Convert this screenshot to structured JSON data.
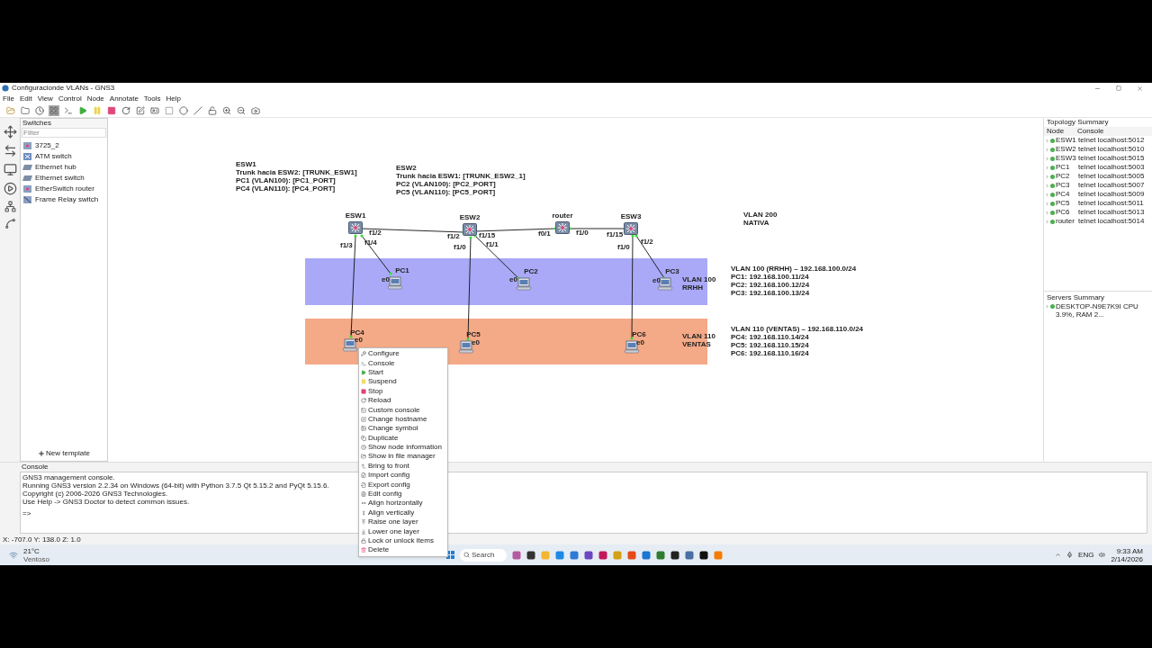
{
  "window": {
    "title": "Configuracionde VLANs - GNS3"
  },
  "menu": [
    "File",
    "Edit",
    "View",
    "Control",
    "Node",
    "Annotate",
    "Tools",
    "Help"
  ],
  "toolbar": {
    "toggle_pressed": true
  },
  "switches_panel": {
    "title": "Switches",
    "filter_placeholder": "Filter",
    "items": [
      {
        "label": "3725_2",
        "kind": "router"
      },
      {
        "label": "ATM switch",
        "kind": "atm"
      },
      {
        "label": "Ethernet hub",
        "kind": "hub"
      },
      {
        "label": "Ethernet switch",
        "kind": "hub"
      },
      {
        "label": "EtherSwitch router",
        "kind": "router"
      },
      {
        "label": "Frame Relay switch",
        "kind": "frame"
      }
    ],
    "new_template": "New template"
  },
  "canvas": {
    "zones": [
      {
        "color": "#a9a9f7"
      },
      {
        "color": "#f4a987"
      }
    ],
    "notes": [
      {
        "lines": [
          "ESW1",
          "Trunk hacia ESW2: [TRUNK_ESW1]",
          "PC1 (VLAN100): [PC1_PORT]",
          "PC4 (VLAN110): [PC4_PORT]"
        ]
      },
      {
        "lines": [
          "ESW2",
          "Trunk hacia ESW1: [TRUNK_ESW2_1]",
          "PC2 (VLAN100): [PC2_PORT]",
          "PC5 (VLAN110): [PC5_PORT]"
        ]
      },
      {
        "lines": [
          "VLAN 200",
          "NATIVA"
        ]
      },
      {
        "lines": [
          "VLAN 100",
          "RRHH"
        ]
      },
      {
        "lines": [
          "VLAN 100 (RRHH) – 192.168.100.0/24",
          "PC1: 192.168.100.11/24",
          "PC2: 192.168.100.12/24",
          "PC3: 192.168.100.13/24"
        ]
      },
      {
        "lines": [
          "VLAN 110",
          "VENTAS"
        ]
      },
      {
        "lines": [
          "VLAN 110 (VENTAS) – 192.168.110.0/24",
          "PC4: 192.168.110.14/24",
          "PC5: 192.168.110.15/24",
          "PC6: 192.168.110.16/24"
        ]
      }
    ],
    "nodes": [
      {
        "label": "ESW1",
        "kind": "switch"
      },
      {
        "label": "ESW2",
        "kind": "switch"
      },
      {
        "label": "router",
        "kind": "switch"
      },
      {
        "label": "ESW3",
        "kind": "switch"
      },
      {
        "label": "PC1",
        "kind": "pc"
      },
      {
        "label": "PC2",
        "kind": "pc"
      },
      {
        "label": "PC3",
        "kind": "pc"
      },
      {
        "label": "PC4",
        "kind": "pc"
      },
      {
        "label": "PC5",
        "kind": "pc"
      },
      {
        "label": "PC6",
        "kind": "pc"
      }
    ],
    "port_labels": [
      "f1/2",
      "f1/3",
      "f1/4",
      "f1/2",
      "f1/15",
      "f1/1",
      "f1/0",
      "f0/1",
      "f1/0",
      "f1/15",
      "f1/0",
      "f1/2",
      "e0",
      "e0",
      "e0",
      "e0",
      "e0",
      "e0"
    ]
  },
  "topology_summary": {
    "title": "Topology Summary",
    "columns": [
      "Node",
      "Console"
    ],
    "rows": [
      {
        "node": "ESW1",
        "console": "telnet localhost:5012",
        "started": true
      },
      {
        "node": "ESW2",
        "console": "telnet localhost:5010",
        "started": true
      },
      {
        "node": "ESW3",
        "console": "telnet localhost:5015",
        "started": true
      },
      {
        "node": "PC1",
        "console": "telnet localhost:5003",
        "started": true
      },
      {
        "node": "PC2",
        "console": "telnet localhost:5005",
        "started": true
      },
      {
        "node": "PC3",
        "console": "telnet localhost:5007",
        "started": true
      },
      {
        "node": "PC4",
        "console": "telnet localhost:5009",
        "started": true
      },
      {
        "node": "PC5",
        "console": "telnet localhost:5011",
        "started": true
      },
      {
        "node": "PC6",
        "console": "telnet localhost:5013",
        "started": true
      },
      {
        "node": "router",
        "console": "telnet localhost:5014",
        "started": true
      }
    ]
  },
  "servers_summary": {
    "title": "Servers Summary",
    "rows": [
      {
        "text": "DESKTOP-N9E7K9I CPU 3.9%, RAM 2...",
        "started": true
      }
    ]
  },
  "console": {
    "title": "Console",
    "lines": [
      "GNS3 management console.",
      "Running GNS3 version 2.2.34 on Windows (64-bit) with Python 3.7.5 Qt 5.15.2 and PyQt 5.15.6.",
      "Copyright (c) 2006-2026 GNS3 Technologies.",
      "Use Help -> GNS3 Doctor to detect common issues."
    ],
    "prompt": "=>"
  },
  "status_bar": "X: -707.0 Y: 138.0 Z: 1.0",
  "context_menu": [
    "Configure",
    "Console",
    "Start",
    "Suspend",
    "Stop",
    "Reload",
    "Custom console",
    "Change hostname",
    "Change symbol",
    "Duplicate",
    "Show node information",
    "Show in file manager",
    "Bring to front",
    "Import config",
    "Export config",
    "Edit config",
    "Align horizontally",
    "Align vertically",
    "Raise one layer",
    "Lower one layer",
    "Lock or unlock items",
    "Delete"
  ],
  "taskbar": {
    "temperature": "21°C",
    "weather": "Ventoso",
    "search_placeholder": "Search",
    "language": "ENG",
    "time": "9:33 AM",
    "date": "2/14/2026"
  }
}
